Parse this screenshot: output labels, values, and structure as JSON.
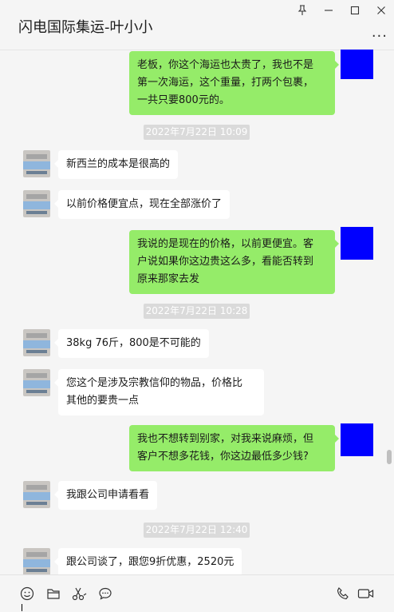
{
  "window": {
    "title": "闪电国际集运-叶小小"
  },
  "controls": {
    "more": "..."
  },
  "messages": [
    {
      "type": "out",
      "text": "老板，你这个海运也太贵了，我也不是\n第一次海运，这个重量，打两个包裹，\n一共只要800元的。"
    },
    {
      "type": "time",
      "text": "2022年7月22日 10:09"
    },
    {
      "type": "in",
      "text": "新西兰的成本是很高的"
    },
    {
      "type": "in",
      "text": "以前价格便宜点，现在全部涨价了"
    },
    {
      "type": "out",
      "text": "我说的是现在的价格，以前更便宜。客\n户说如果你这边贵这么多，看能否转到\n原来那家去发"
    },
    {
      "type": "time",
      "text": "2022年7月22日 10:28"
    },
    {
      "type": "in",
      "text": "38kg 76斤，800是不可能的"
    },
    {
      "type": "in",
      "text": "您这个是涉及宗教信仰的物品，价格比\n其他的要贵一点"
    },
    {
      "type": "out",
      "text": "我也不想转到别家，对我来说麻烦，但\n客户不想多花钱，你这边最低多少钱?"
    },
    {
      "type": "in",
      "text": "我跟公司申请看看"
    },
    {
      "type": "time",
      "text": "2022年7月22日 12:40"
    },
    {
      "type": "in",
      "text": "跟公司谈了，跟您9折优惠，2520元"
    }
  ],
  "toolbar": {
    "left_icons": [
      "emoji-icon",
      "folder-icon",
      "scissors-icon",
      "chat-bubble-icon"
    ],
    "right_icons": [
      "phone-icon",
      "video-call-icon"
    ]
  },
  "colors": {
    "outgoing_bubble": "#95ec69",
    "incoming_bubble": "#ffffff",
    "my_avatar": "#0000ff",
    "timestamp_bg": "#dadada"
  }
}
